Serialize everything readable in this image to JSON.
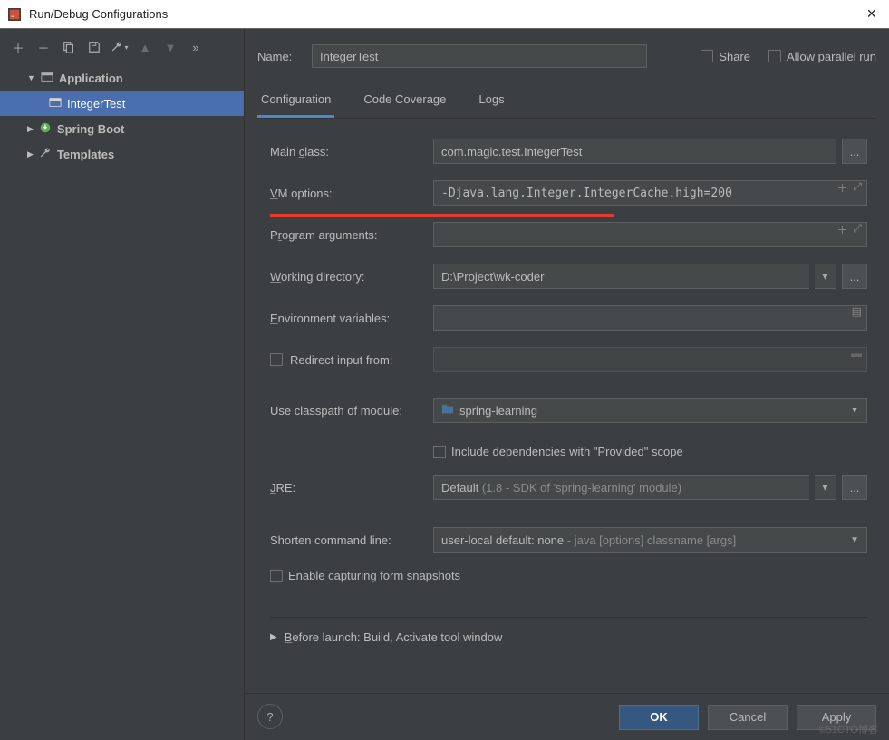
{
  "window": {
    "title": "Run/Debug Configurations"
  },
  "tree": {
    "root": "Application",
    "item_selected": "IntegerTest",
    "spring": "Spring Boot",
    "templates": "Templates"
  },
  "header": {
    "name_label": "Name:",
    "name_value": "IntegerTest",
    "share_label": "Share",
    "allow_parallel_label": "Allow parallel run"
  },
  "tabs": {
    "config": "Configuration",
    "coverage": "Code Coverage",
    "logs": "Logs"
  },
  "form": {
    "main_class_label": "Main class:",
    "main_class_value": "com.magic.test.IntegerTest",
    "vm_options_label": "VM options:",
    "vm_options_value": "-Djava.lang.Integer.IntegerCache.high=200",
    "program_args_label": "Program arguments:",
    "program_args_value": "",
    "working_dir_label": "Working directory:",
    "working_dir_value": "D:\\Project\\wk-coder",
    "env_vars_label": "Environment variables:",
    "env_vars_value": "",
    "redirect_label": "Redirect input from:",
    "classpath_label": "Use classpath of module:",
    "classpath_value": "spring-learning",
    "include_deps_label": "Include dependencies with \"Provided\" scope",
    "jre_label": "JRE:",
    "jre_value_default": "Default",
    "jre_value_detail": " (1.8 - SDK of 'spring-learning' module)",
    "shorten_label": "Shorten command line:",
    "shorten_value": "user-local default: none",
    "shorten_detail": " - java [options] classname [args]",
    "enable_snapshots_label": "Enable capturing form snapshots",
    "before_launch_label": "Before launch: Build, Activate tool window"
  },
  "footer": {
    "ok": "OK",
    "cancel": "Cancel",
    "apply": "Apply"
  },
  "watermark": "©51CTO博客"
}
